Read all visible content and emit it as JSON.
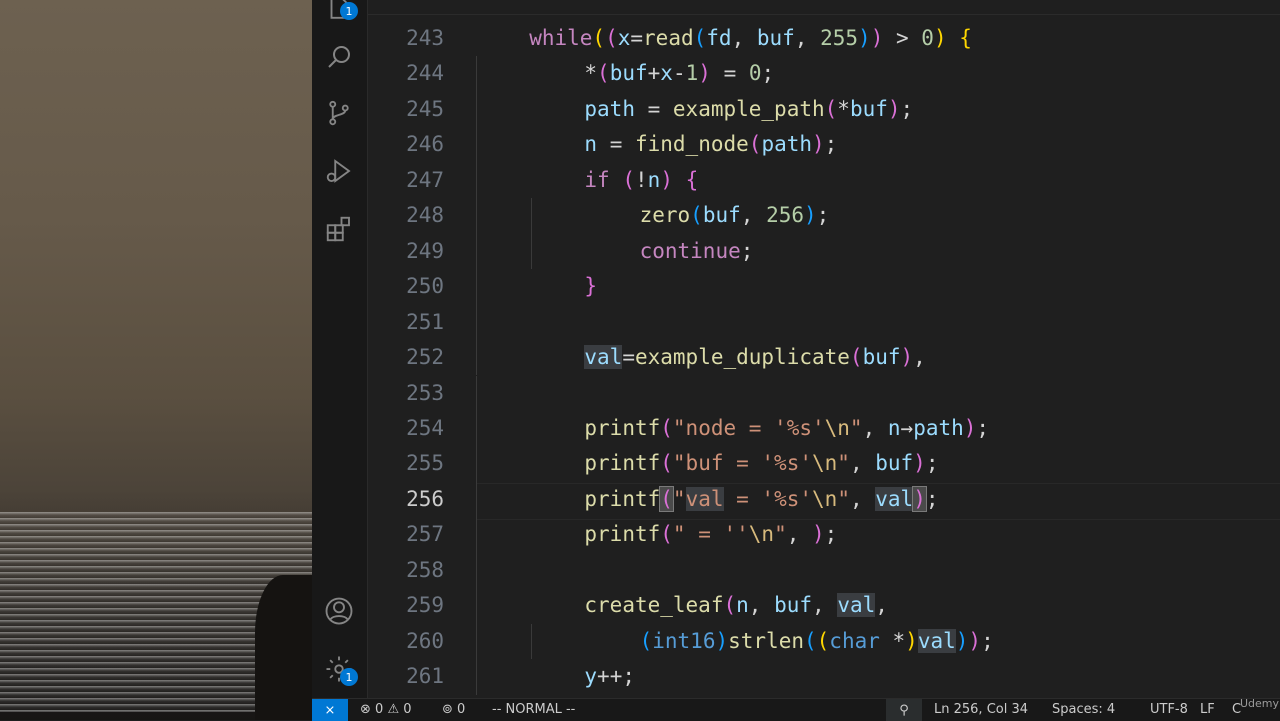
{
  "activity_bar": {
    "explorer_badge": "1",
    "settings_badge": "1",
    "icons": [
      "files-icon",
      "search-icon",
      "source-control-icon",
      "run-debug-icon",
      "extensions-icon",
      "account-icon",
      "settings-gear-icon"
    ]
  },
  "editor": {
    "lines": [
      {
        "num": "243",
        "segments": [
          [
            "kw",
            "while"
          ],
          [
            "p1",
            "("
          ],
          [
            "p2",
            "("
          ],
          [
            "var",
            "x"
          ],
          [
            "op",
            "="
          ],
          [
            "fn",
            "read"
          ],
          [
            "p3",
            "("
          ],
          [
            "var",
            "fd"
          ],
          [
            "op",
            ", "
          ],
          [
            "var",
            "buf"
          ],
          [
            "op",
            ", "
          ],
          [
            "num",
            "255"
          ],
          [
            "p3",
            ")"
          ],
          [
            "p2",
            ")"
          ],
          [
            "op",
            " > "
          ],
          [
            "num",
            "0"
          ],
          [
            "p1",
            ")"
          ],
          [
            "op",
            " "
          ],
          [
            "p1",
            "{"
          ]
        ]
      },
      {
        "num": "244",
        "segments": [
          [
            "op",
            "*"
          ],
          [
            "p2",
            "("
          ],
          [
            "var",
            "buf"
          ],
          [
            "op",
            "+"
          ],
          [
            "var",
            "x"
          ],
          [
            "op",
            "-"
          ],
          [
            "num",
            "1"
          ],
          [
            "p2",
            ")"
          ],
          [
            "op",
            " = "
          ],
          [
            "num",
            "0"
          ],
          [
            "op",
            ";"
          ]
        ]
      },
      {
        "num": "245",
        "segments": [
          [
            "var",
            "path"
          ],
          [
            "op",
            " = "
          ],
          [
            "fn",
            "example_path"
          ],
          [
            "p2",
            "("
          ],
          [
            "op",
            "*"
          ],
          [
            "var",
            "buf"
          ],
          [
            "p2",
            ")"
          ],
          [
            "op",
            ";"
          ]
        ]
      },
      {
        "num": "246",
        "segments": [
          [
            "var",
            "n"
          ],
          [
            "op",
            " = "
          ],
          [
            "fn",
            "find_node"
          ],
          [
            "p2",
            "("
          ],
          [
            "var",
            "path"
          ],
          [
            "p2",
            ")"
          ],
          [
            "op",
            ";"
          ]
        ]
      },
      {
        "num": "247",
        "segments": [
          [
            "kw",
            "if"
          ],
          [
            "op",
            " "
          ],
          [
            "p2",
            "("
          ],
          [
            "op",
            "!"
          ],
          [
            "var",
            "n"
          ],
          [
            "p2",
            ")"
          ],
          [
            "op",
            " "
          ],
          [
            "p2",
            "{"
          ]
        ]
      },
      {
        "num": "248",
        "segments": [
          [
            "fn",
            "zero"
          ],
          [
            "p3",
            "("
          ],
          [
            "var",
            "buf"
          ],
          [
            "op",
            ", "
          ],
          [
            "num",
            "256"
          ],
          [
            "p3",
            ")"
          ],
          [
            "op",
            ";"
          ]
        ]
      },
      {
        "num": "249",
        "segments": [
          [
            "kw",
            "continue"
          ],
          [
            "op",
            ";"
          ]
        ]
      },
      {
        "num": "250",
        "segments": [
          [
            "p2",
            "}"
          ]
        ]
      },
      {
        "num": "251",
        "segments": []
      },
      {
        "num": "252",
        "segments": [
          [
            "hlvar",
            "val"
          ],
          [
            "op",
            "="
          ],
          [
            "fn",
            "example_duplicate"
          ],
          [
            "p2",
            "("
          ],
          [
            "var",
            "buf"
          ],
          [
            "p2",
            ")"
          ],
          [
            "op",
            ","
          ]
        ]
      },
      {
        "num": "253",
        "segments": []
      },
      {
        "num": "254",
        "segments": [
          [
            "fn",
            "printf"
          ],
          [
            "p2",
            "("
          ],
          [
            "str",
            "\"node = '%s'"
          ],
          [
            "esc",
            "\\n"
          ],
          [
            "str",
            "\""
          ],
          [
            "op",
            ", "
          ],
          [
            "var",
            "n"
          ],
          [
            "op",
            "→"
          ],
          [
            "var",
            "path"
          ],
          [
            "p2",
            ")"
          ],
          [
            "op",
            ";"
          ]
        ]
      },
      {
        "num": "255",
        "segments": [
          [
            "fn",
            "printf"
          ],
          [
            "p2",
            "("
          ],
          [
            "str",
            "\"buf = '%s'"
          ],
          [
            "esc",
            "\\n"
          ],
          [
            "str",
            "\""
          ],
          [
            "op",
            ", "
          ],
          [
            "var",
            "buf"
          ],
          [
            "p2",
            ")"
          ],
          [
            "op",
            ";"
          ]
        ]
      },
      {
        "num": "256",
        "segments": [
          [
            "fn",
            "printf"
          ],
          [
            "cursorp",
            "("
          ],
          [
            "str",
            "\""
          ],
          [
            "hlstr",
            "val"
          ],
          [
            "str",
            " = '%s'"
          ],
          [
            "esc",
            "\\n"
          ],
          [
            "str",
            "\""
          ],
          [
            "op",
            ", "
          ],
          [
            "hlvar",
            "val"
          ],
          [
            "cursorp",
            ")"
          ],
          [
            "op",
            ";"
          ]
        ]
      },
      {
        "num": "257",
        "segments": [
          [
            "fn",
            "printf"
          ],
          [
            "p2",
            "("
          ],
          [
            "str",
            "\" = ''"
          ],
          [
            "esc",
            "\\n"
          ],
          [
            "str",
            "\""
          ],
          [
            "op",
            ", "
          ],
          [
            "p2",
            ")"
          ],
          [
            "op",
            ";"
          ]
        ]
      },
      {
        "num": "258",
        "segments": []
      },
      {
        "num": "259",
        "segments": [
          [
            "fn",
            "create_leaf"
          ],
          [
            "p2",
            "("
          ],
          [
            "var",
            "n"
          ],
          [
            "op",
            ", "
          ],
          [
            "var",
            "buf"
          ],
          [
            "op",
            ", "
          ],
          [
            "hlvar",
            "val"
          ],
          [
            "op",
            ","
          ]
        ]
      },
      {
        "num": "260",
        "segments": [
          [
            "p3",
            "("
          ],
          [
            "type",
            "int16"
          ],
          [
            "p3",
            ")"
          ],
          [
            "fn",
            "strlen"
          ],
          [
            "p3",
            "("
          ],
          [
            "p1",
            "("
          ],
          [
            "type",
            "char"
          ],
          [
            "op",
            " *"
          ],
          [
            "p1",
            ")"
          ],
          [
            "hlvar",
            "val"
          ],
          [
            "p3",
            ")"
          ],
          [
            "p2",
            ")"
          ],
          [
            "op",
            ";"
          ]
        ]
      },
      {
        "num": "261",
        "segments": [
          [
            "var",
            "y"
          ],
          [
            "op",
            "++;"
          ]
        ]
      }
    ],
    "indents": [
      4,
      5,
      5,
      5,
      5,
      6,
      6,
      5,
      5,
      5,
      5,
      5,
      5,
      5,
      5,
      5,
      5,
      6,
      5
    ],
    "active_line": "256"
  },
  "status_bar": {
    "errors": "0",
    "warnings": "0",
    "ports": "0",
    "mode": "-- NORMAL --",
    "position": "Ln 256, Col 34",
    "spaces": "Spaces: 4",
    "encoding": "UTF-8",
    "eol": "LF",
    "language": "C",
    "watermark": "Udemy"
  }
}
